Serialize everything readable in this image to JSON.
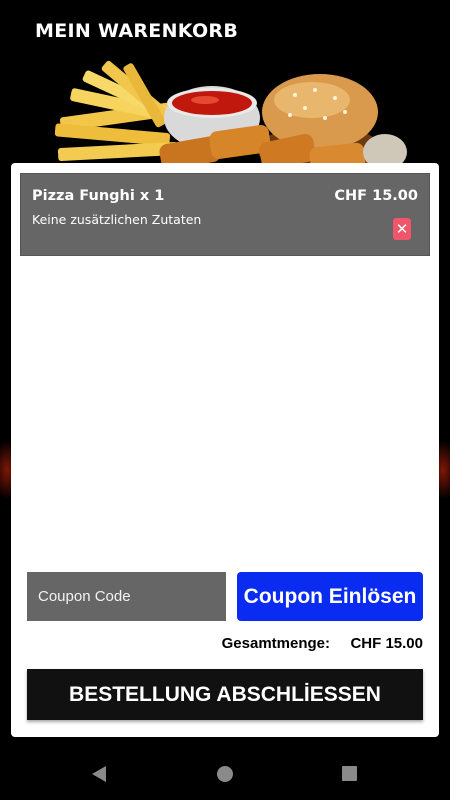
{
  "header": {
    "title": "MEIN WARENKORB"
  },
  "cart": {
    "items": [
      {
        "name": "Pizza Funghi x 1",
        "price": "CHF 15.00",
        "extras": "Keine zusätzlichen Zutaten",
        "remove_icon": "close-icon",
        "remove_glyph": "✕"
      }
    ]
  },
  "coupon": {
    "placeholder": "Coupon Code",
    "value": "",
    "button_label": "Coupon Einlösen"
  },
  "total": {
    "label": "Gesamtmenge:",
    "value": "CHF 15.00"
  },
  "checkout": {
    "label": "BESTELLUNG ABSCHLİESSEN"
  },
  "colors": {
    "background": "#000000",
    "item_background": "#666666",
    "remove_button": "#f0556a",
    "coupon_button": "#0a2cf0",
    "checkout_button": "#111111"
  },
  "nav": {
    "icons": [
      "back-icon",
      "home-icon",
      "recents-icon"
    ]
  }
}
